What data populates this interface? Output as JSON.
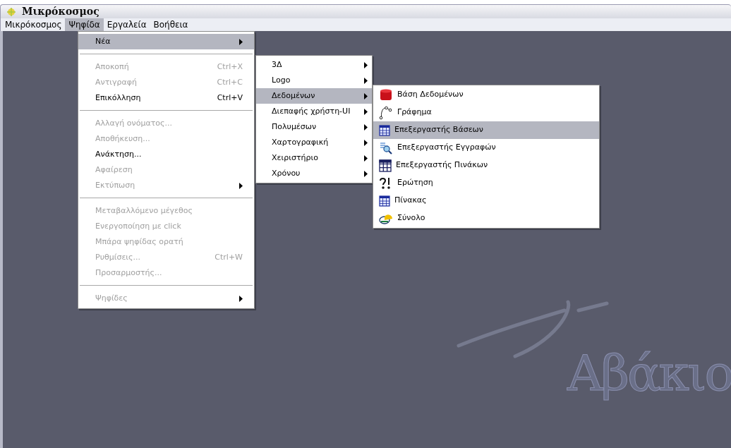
{
  "window": {
    "title": "Μικρόκοσμος"
  },
  "menu_bar": [
    {
      "label": "Μικρόκοσμος",
      "selected": false
    },
    {
      "label": "Ψηφίδα",
      "selected": true
    },
    {
      "label": "Εργαλεία",
      "selected": false
    },
    {
      "label": "Βοήθεια",
      "selected": false
    }
  ],
  "menu": [
    {
      "kind": "item",
      "label": "Νέα",
      "selected": true,
      "disabled": false,
      "submenu": true
    },
    {
      "kind": "separator"
    },
    {
      "kind": "item",
      "label": "Αποκοπή",
      "shortcut": "Ctrl+X",
      "selected": false,
      "disabled": true,
      "submenu": false
    },
    {
      "kind": "item",
      "label": "Αντιγραφή",
      "shortcut": "Ctrl+C",
      "selected": false,
      "disabled": true,
      "submenu": false
    },
    {
      "kind": "item",
      "label": "Επικόλληση",
      "shortcut": "Ctrl+V",
      "selected": false,
      "disabled": false,
      "submenu": false
    },
    {
      "kind": "separator"
    },
    {
      "kind": "item",
      "label": "Αλλαγή ονόματος...",
      "selected": false,
      "disabled": true,
      "submenu": false
    },
    {
      "kind": "item",
      "label": "Αποθήκευση...",
      "selected": false,
      "disabled": true,
      "submenu": false
    },
    {
      "kind": "item",
      "label": "Ανάκτηση...",
      "selected": false,
      "disabled": false,
      "submenu": false
    },
    {
      "kind": "item",
      "label": "Αφαίρεση",
      "selected": false,
      "disabled": true,
      "submenu": false
    },
    {
      "kind": "item",
      "label": "Εκτύπωση",
      "selected": false,
      "disabled": true,
      "submenu": true
    },
    {
      "kind": "separator"
    },
    {
      "kind": "item",
      "label": "Μεταβαλλόμενο μέγεθος",
      "selected": false,
      "disabled": true,
      "submenu": false
    },
    {
      "kind": "item",
      "label": "Ενεργοποίηση με click",
      "selected": false,
      "disabled": true,
      "submenu": false
    },
    {
      "kind": "item",
      "label": "Μπάρα ψηφίδας ορατή",
      "selected": false,
      "disabled": true,
      "submenu": false
    },
    {
      "kind": "item",
      "label": "Ρυθμίσεις...",
      "shortcut": "Ctrl+W",
      "selected": false,
      "disabled": true,
      "submenu": false
    },
    {
      "kind": "item",
      "label": "Προσαρμοστής...",
      "selected": false,
      "disabled": true,
      "submenu": false
    },
    {
      "kind": "separator"
    },
    {
      "kind": "item",
      "label": "Ψηφίδες",
      "selected": false,
      "disabled": true,
      "submenu": true
    }
  ],
  "new_submenu": [
    {
      "label": "3Δ",
      "selected": false
    },
    {
      "label": "Logo",
      "selected": false
    },
    {
      "label": "Δεδομένων",
      "selected": true
    },
    {
      "label": "Διεπαφής χρήστη-UI",
      "selected": false
    },
    {
      "label": "Πολυμέσων",
      "selected": false
    },
    {
      "label": "Χαρτογραφική",
      "selected": false
    },
    {
      "label": "Χειριστήριο",
      "selected": false
    },
    {
      "label": "Χρόνου",
      "selected": false
    }
  ],
  "data_submenu": [
    {
      "label": "Βάση Δεδομένων",
      "selected": false
    },
    {
      "label": "Γράφημα",
      "selected": false
    },
    {
      "label": "Επεξεργαστής Βάσεων",
      "selected": true
    },
    {
      "label": "Επεξεργαστής Εγγραφών",
      "selected": false
    },
    {
      "label": "Επεξεργαστής Πινάκων",
      "selected": false
    },
    {
      "label": "Ερώτηση",
      "selected": false
    },
    {
      "label": "Πίνακας",
      "selected": false
    },
    {
      "label": "Σύνολο",
      "selected": false
    }
  ],
  "background_logo": {
    "text": "Αβάκιο"
  }
}
